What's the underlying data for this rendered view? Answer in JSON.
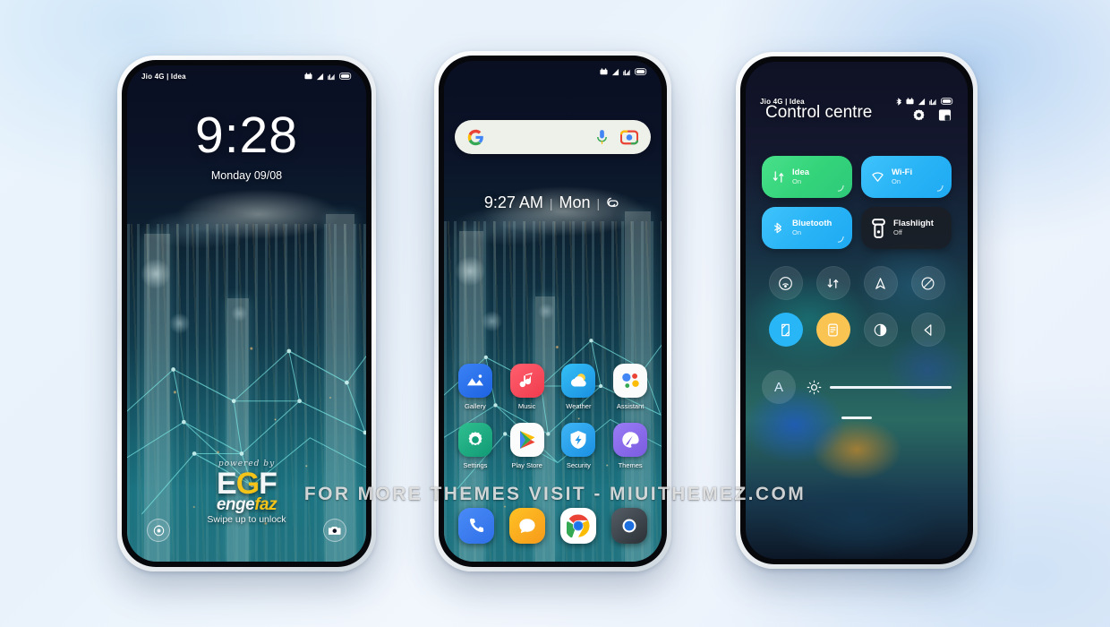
{
  "watermark": "FOR MORE THEMES VISIT - MIUITHEMEZ.COM",
  "colors": {
    "accent_green": "#33d37a",
    "accent_blue": "#28b3f6",
    "accent_amber": "#f9c452",
    "tile_dark": "#1a1e24",
    "brand_yellow": "#f4c319"
  },
  "phone1": {
    "name": "lock-screen",
    "status": {
      "carrier": "Jio 4G | Idea",
      "icons": [
        "alarm-icon",
        "signal-icon",
        "signal-alt-icon",
        "battery-icon"
      ]
    },
    "clock": {
      "time": "9:28",
      "date": "Monday 09/08"
    },
    "brand": {
      "powered_by": "powered  by",
      "logo": "EGF",
      "logo_g": "G",
      "sub": "engefaz"
    },
    "swipe_hint": "Swipe up to unlock",
    "left_button": "flashlight-icon",
    "right_button": "camera-icon"
  },
  "phone2": {
    "name": "home-screen",
    "status": {
      "carrier": "",
      "icons": [
        "alarm-icon",
        "signal-icon",
        "signal-alt-icon",
        "battery-icon"
      ]
    },
    "search": {
      "placeholder": "",
      "logo": "google-g-icon",
      "mic": "mic-icon",
      "lens": "google-lens-icon"
    },
    "clock_widget": {
      "time": "9:27 AM",
      "sep": "|",
      "day": "Mon",
      "weather": "weather-cloud-icon"
    },
    "apps": [
      {
        "label": "Gallery",
        "icon": "gallery-icon"
      },
      {
        "label": "Music",
        "icon": "music-icon"
      },
      {
        "label": "Weather",
        "icon": "weather-icon"
      },
      {
        "label": "Assistant",
        "icon": "assistant-icon"
      },
      {
        "label": "Settings",
        "icon": "settings-icon"
      },
      {
        "label": "Play Store",
        "icon": "play-store-icon"
      },
      {
        "label": "Security",
        "icon": "security-icon"
      },
      {
        "label": "Themes",
        "icon": "themes-icon"
      }
    ],
    "dock": [
      {
        "label": "Phone",
        "icon": "phone-icon"
      },
      {
        "label": "Messages",
        "icon": "messages-icon"
      },
      {
        "label": "Chrome",
        "icon": "chrome-icon"
      },
      {
        "label": "Camera",
        "icon": "camera-app-icon"
      }
    ]
  },
  "phone3": {
    "name": "control-centre",
    "status": {
      "carrier": "Jio 4G | Idea",
      "icons": [
        "bluetooth-icon",
        "alarm-icon",
        "signal-icon",
        "signal-alt-icon",
        "battery-icon"
      ]
    },
    "title": "Control centre",
    "header_icons": [
      "settings-gear-icon",
      "edit-tiles-icon"
    ],
    "big_tiles": [
      {
        "name": "Idea",
        "state": "On",
        "style": "green",
        "icon": "mobile-data-icon"
      },
      {
        "name": "Wi-Fi",
        "state": "On",
        "style": "blue",
        "icon": "wifi-icon"
      },
      {
        "name": "Bluetooth",
        "state": "On",
        "style": "blue",
        "icon": "bluetooth-tile-icon"
      },
      {
        "name": "Flashlight",
        "state": "Off",
        "style": "dark",
        "icon": "flashlight-tile-icon"
      }
    ],
    "toggles": [
      {
        "icon": "hotspot-icon",
        "active": false
      },
      {
        "icon": "data-saver-icon",
        "active": false
      },
      {
        "icon": "location-icon",
        "active": false
      },
      {
        "icon": "dnd-icon",
        "active": false
      },
      {
        "icon": "screenshot-icon",
        "active": true,
        "tone": "blue"
      },
      {
        "icon": "notes-icon",
        "active": true,
        "tone": "amber"
      },
      {
        "icon": "dark-mode-icon",
        "active": false
      },
      {
        "icon": "sound-icon",
        "active": false
      }
    ],
    "brightness": {
      "auto_label": "A",
      "icon": "brightness-icon",
      "value": 100
    }
  }
}
